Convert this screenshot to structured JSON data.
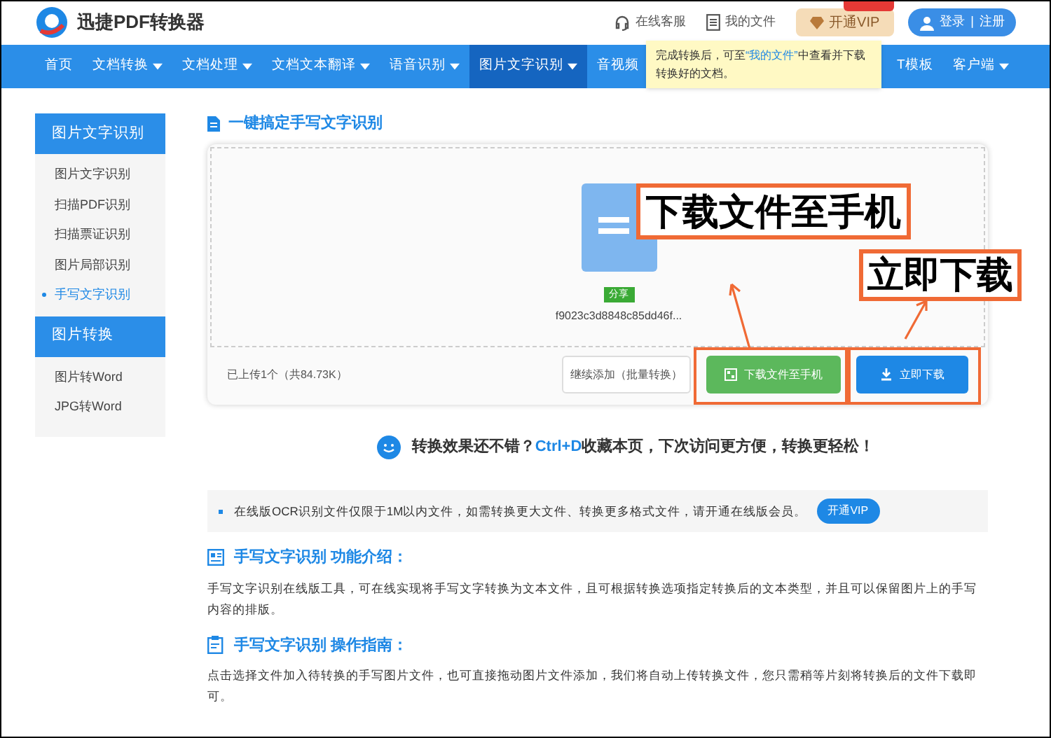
{
  "header": {
    "logo_text": "迅捷PDF转换器",
    "links": [
      {
        "kind": "service",
        "label": "在线客服"
      },
      {
        "kind": "files",
        "label": "我的文件"
      }
    ],
    "vip_button": "开通VIP",
    "login": "登录",
    "separator": "|",
    "register": "注册"
  },
  "nav": {
    "items": [
      {
        "label": "首页",
        "dropdown": false,
        "selected": false
      },
      {
        "label": "文档转换",
        "dropdown": true,
        "selected": false
      },
      {
        "label": "文档处理",
        "dropdown": true,
        "selected": false
      },
      {
        "label": "文档文本翻译",
        "dropdown": true,
        "selected": false
      },
      {
        "label": "语音识别",
        "dropdown": true,
        "selected": false
      },
      {
        "label": "图片文字识别",
        "dropdown": true,
        "selected": true
      },
      {
        "label": "音视频",
        "dropdown": false,
        "selected": false
      },
      {
        "label": "T模板",
        "dropdown": false,
        "selected": false
      },
      {
        "label": "客户端",
        "dropdown": true,
        "selected": false
      }
    ]
  },
  "tooltip": {
    "before": "完成转换后，可至",
    "link": "“我的文件”",
    "after": "中查看并下载转换好的文档。"
  },
  "sidebar": {
    "sections": [
      {
        "title": "图片文字识别",
        "items": [
          {
            "label": "图片文字识别",
            "selected": false
          },
          {
            "label": "扫描PDF识别",
            "selected": false
          },
          {
            "label": "扫描票证识别",
            "selected": false
          },
          {
            "label": "图片局部识别",
            "selected": false
          },
          {
            "label": "手写文字识别",
            "selected": true
          }
        ]
      },
      {
        "title": "图片转换",
        "items": [
          {
            "label": "图片转Word",
            "selected": false
          },
          {
            "label": "JPG转Word",
            "selected": false
          }
        ]
      }
    ]
  },
  "upload": {
    "title": "一键搞定手写文字识别",
    "file": {
      "badge": "分享",
      "name": "f9023c3d8848c85dd46f..."
    },
    "count": "已上传1个（共84.73K）",
    "buttons": [
      {
        "kind": "add",
        "label": "继续添加（批量转换）"
      },
      {
        "kind": "phone",
        "label": "下载文件至手机"
      },
      {
        "kind": "download",
        "label": "立即下载"
      }
    ]
  },
  "callouts": [
    "下载文件至手机",
    "立即下载"
  ],
  "tip": {
    "before": "转换效果还不错？",
    "shortcut": "Ctrl+D",
    "after": "收藏本页，下次访问更方便，转换更轻松！"
  },
  "notice": {
    "text": "在线版OCR识别文件仅限于1M以内文件，如需转换更大文件、转换更多格式文件，请开通在线版会员。",
    "button": "开通VIP"
  },
  "sections": [
    {
      "kind": "intro",
      "title": "手写文字识别",
      "subtitle": "功能介绍：",
      "body": "手写文字识别在线版工具，可在线实现将手写文字转换为文本文件，且可根据转换选项指定转换后的文本类型，并且可以保留图片上的手写内容的排版。"
    },
    {
      "kind": "guide",
      "title": "手写文字识别",
      "subtitle": "操作指南：",
      "body": "点击选择文件加入待转换的手写图片文件，也可直接拖动图片文件添加，我们将自动上传转换文件，您只需稍等片刻将转换后的文件下载即可。"
    }
  ]
}
